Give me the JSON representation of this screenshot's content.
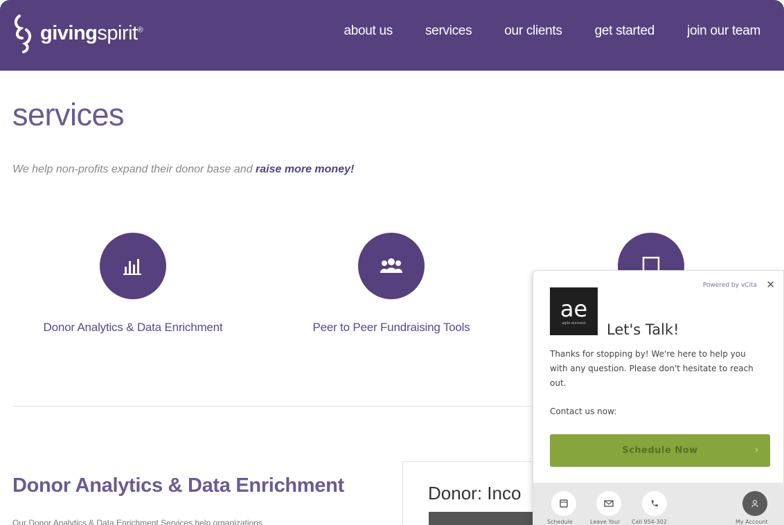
{
  "header": {
    "logo": {
      "bold": "giving",
      "regular": "spirit",
      "mark": "®"
    },
    "nav": [
      "about us",
      "services",
      "our clients",
      "get started",
      "join our team"
    ]
  },
  "main": {
    "title": "services",
    "tagline_prefix": "We help non-profits expand their donor base and ",
    "tagline_emphasis": "raise more money!",
    "services": [
      {
        "label": "Donor Analytics & Data Enrichment",
        "icon": "bar-chart-icon"
      },
      {
        "label": "Peer to Peer Fundraising Tools",
        "icon": "people-group-icon"
      },
      {
        "label": "",
        "icon": "tablet-icon"
      }
    ],
    "section_title": "Donor Analytics & Data Enrichment",
    "section_text": "Our Donor Analytics & Data Enrichment Services help organizations",
    "donor_card_title": "Donor: Inco"
  },
  "chat": {
    "powered_by": "Powered by vCita",
    "avatar_text": "ae",
    "avatar_subtext": "agile element",
    "headline": "Let's Talk!",
    "message": "Thanks for stopping by! We're here to help you with any question. Please don't hesitate to reach out.",
    "contact_label": "Contact us now:",
    "button_label": "Schedule Now",
    "footer": [
      "Schedule",
      "Leave Your",
      "Call 954-302",
      "My Account"
    ],
    "colors": {
      "button": "#86a53a",
      "brand": "#56407e"
    }
  }
}
